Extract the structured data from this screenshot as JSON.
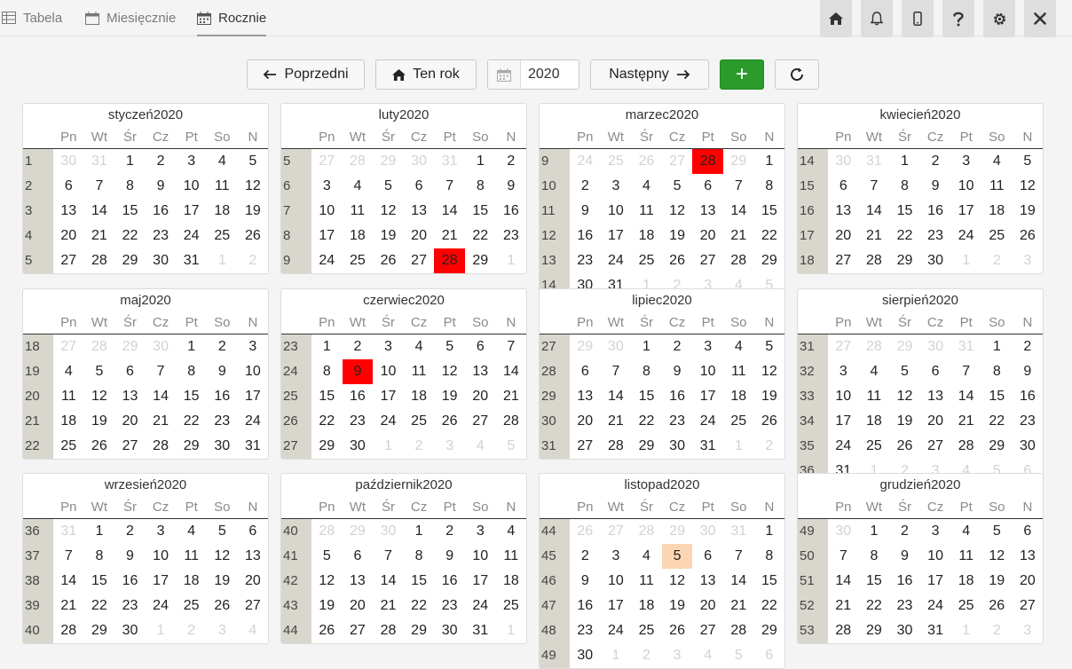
{
  "tabs": [
    {
      "label": "Tabela",
      "icon": "table-icon"
    },
    {
      "label": "Miesięcznie",
      "icon": "calendar-icon"
    },
    {
      "label": "Rocznie",
      "icon": "grid-calendar-icon"
    }
  ],
  "toolbar_icons": [
    "home-icon",
    "bell-icon",
    "phone-icon",
    "help-icon",
    "gear-icon",
    "close-icon"
  ],
  "nav": {
    "prev_label": "Poprzedni",
    "this_year_label": "Ten rok",
    "year_value": "2020",
    "next_label": "Następny",
    "add_label": "+"
  },
  "colors": {
    "accent_green": "#2b9b2b",
    "highlight_red": "#ff0000",
    "highlight_peach": "#fcd6b2",
    "week_column": "#d9d7cd"
  },
  "weekday_headers": [
    "Pn",
    "Wt",
    "Śr",
    "Cz",
    "Pt",
    "So",
    "N"
  ],
  "months": [
    {
      "title": "styczeń2020",
      "rows": [
        [
          "1",
          "30",
          "31",
          "1",
          "2",
          "3",
          "4",
          "5"
        ],
        [
          "2",
          "6",
          "7",
          "8",
          "9",
          "10",
          "11",
          "12"
        ],
        [
          "3",
          "13",
          "14",
          "15",
          "16",
          "17",
          "18",
          "19"
        ],
        [
          "4",
          "20",
          "21",
          "22",
          "23",
          "24",
          "25",
          "26"
        ],
        [
          "5",
          "27",
          "28",
          "29",
          "30",
          "31",
          "1",
          "2"
        ]
      ]
    },
    {
      "title": "luty2020",
      "rows": [
        [
          "5",
          "27",
          "28",
          "29",
          "30",
          "31",
          "1",
          "2"
        ],
        [
          "6",
          "3",
          "4",
          "5",
          "6",
          "7",
          "8",
          "9"
        ],
        [
          "7",
          "10",
          "11",
          "12",
          "13",
          "14",
          "15",
          "16"
        ],
        [
          "8",
          "17",
          "18",
          "19",
          "20",
          "21",
          "22",
          "23"
        ],
        [
          "9",
          "24",
          "25",
          "26",
          "27",
          "28",
          "29",
          "1"
        ]
      ]
    },
    {
      "title": "marzec2020",
      "rows": [
        [
          "9",
          "24",
          "25",
          "26",
          "27",
          "28",
          "29",
          "1"
        ],
        [
          "10",
          "2",
          "3",
          "4",
          "5",
          "6",
          "7",
          "8"
        ],
        [
          "11",
          "9",
          "10",
          "11",
          "12",
          "13",
          "14",
          "15"
        ],
        [
          "12",
          "16",
          "17",
          "18",
          "19",
          "20",
          "21",
          "22"
        ],
        [
          "13",
          "23",
          "24",
          "25",
          "26",
          "27",
          "28",
          "29"
        ],
        [
          "14",
          "30",
          "31",
          "1",
          "2",
          "3",
          "4",
          "5"
        ]
      ]
    },
    {
      "title": "kwiecień2020",
      "rows": [
        [
          "14",
          "30",
          "31",
          "1",
          "2",
          "3",
          "4",
          "5"
        ],
        [
          "15",
          "6",
          "7",
          "8",
          "9",
          "10",
          "11",
          "12"
        ],
        [
          "16",
          "13",
          "14",
          "15",
          "16",
          "17",
          "18",
          "19"
        ],
        [
          "17",
          "20",
          "21",
          "22",
          "23",
          "24",
          "25",
          "26"
        ],
        [
          "18",
          "27",
          "28",
          "29",
          "30",
          "1",
          "2",
          "3"
        ]
      ]
    },
    {
      "title": "maj2020",
      "rows": [
        [
          "18",
          "27",
          "28",
          "29",
          "30",
          "1",
          "2",
          "3"
        ],
        [
          "19",
          "4",
          "5",
          "6",
          "7",
          "8",
          "9",
          "10"
        ],
        [
          "20",
          "11",
          "12",
          "13",
          "14",
          "15",
          "16",
          "17"
        ],
        [
          "21",
          "18",
          "19",
          "20",
          "21",
          "22",
          "23",
          "24"
        ],
        [
          "22",
          "25",
          "26",
          "27",
          "28",
          "29",
          "30",
          "31"
        ]
      ]
    },
    {
      "title": "czerwiec2020",
      "rows": [
        [
          "23",
          "1",
          "2",
          "3",
          "4",
          "5",
          "6",
          "7"
        ],
        [
          "24",
          "8",
          "9",
          "10",
          "11",
          "12",
          "13",
          "14"
        ],
        [
          "25",
          "15",
          "16",
          "17",
          "18",
          "19",
          "20",
          "21"
        ],
        [
          "26",
          "22",
          "23",
          "24",
          "25",
          "26",
          "27",
          "28"
        ],
        [
          "27",
          "29",
          "30",
          "1",
          "2",
          "3",
          "4",
          "5"
        ]
      ]
    },
    {
      "title": "lipiec2020",
      "rows": [
        [
          "27",
          "29",
          "30",
          "1",
          "2",
          "3",
          "4",
          "5"
        ],
        [
          "28",
          "6",
          "7",
          "8",
          "9",
          "10",
          "11",
          "12"
        ],
        [
          "29",
          "13",
          "14",
          "15",
          "16",
          "17",
          "18",
          "19"
        ],
        [
          "30",
          "20",
          "21",
          "22",
          "23",
          "24",
          "25",
          "26"
        ],
        [
          "31",
          "27",
          "28",
          "29",
          "30",
          "31",
          "1",
          "2"
        ]
      ]
    },
    {
      "title": "sierpień2020",
      "rows": [
        [
          "31",
          "27",
          "28",
          "29",
          "30",
          "31",
          "1",
          "2"
        ],
        [
          "32",
          "3",
          "4",
          "5",
          "6",
          "7",
          "8",
          "9"
        ],
        [
          "33",
          "10",
          "11",
          "12",
          "13",
          "14",
          "15",
          "16"
        ],
        [
          "34",
          "17",
          "18",
          "19",
          "20",
          "21",
          "22",
          "23"
        ],
        [
          "35",
          "24",
          "25",
          "26",
          "27",
          "28",
          "29",
          "30"
        ],
        [
          "36",
          "31",
          "1",
          "2",
          "3",
          "4",
          "5",
          "6"
        ]
      ]
    },
    {
      "title": "wrzesień2020",
      "rows": [
        [
          "36",
          "31",
          "1",
          "2",
          "3",
          "4",
          "5",
          "6"
        ],
        [
          "37",
          "7",
          "8",
          "9",
          "10",
          "11",
          "12",
          "13"
        ],
        [
          "38",
          "14",
          "15",
          "16",
          "17",
          "18",
          "19",
          "20"
        ],
        [
          "39",
          "21",
          "22",
          "23",
          "24",
          "25",
          "26",
          "27"
        ],
        [
          "40",
          "28",
          "29",
          "30",
          "1",
          "2",
          "3",
          "4"
        ]
      ]
    },
    {
      "title": "październik2020",
      "rows": [
        [
          "40",
          "28",
          "29",
          "30",
          "1",
          "2",
          "3",
          "4"
        ],
        [
          "41",
          "5",
          "6",
          "7",
          "8",
          "9",
          "10",
          "11"
        ],
        [
          "42",
          "12",
          "13",
          "14",
          "15",
          "16",
          "17",
          "18"
        ],
        [
          "43",
          "19",
          "20",
          "21",
          "22",
          "23",
          "24",
          "25"
        ],
        [
          "44",
          "26",
          "27",
          "28",
          "29",
          "30",
          "31",
          "1"
        ]
      ]
    },
    {
      "title": "listopad2020",
      "rows": [
        [
          "44",
          "26",
          "27",
          "28",
          "29",
          "30",
          "31",
          "1"
        ],
        [
          "45",
          "2",
          "3",
          "4",
          "5",
          "6",
          "7",
          "8"
        ],
        [
          "46",
          "9",
          "10",
          "11",
          "12",
          "13",
          "14",
          "15"
        ],
        [
          "47",
          "16",
          "17",
          "18",
          "19",
          "20",
          "21",
          "22"
        ],
        [
          "48",
          "23",
          "24",
          "25",
          "26",
          "27",
          "28",
          "29"
        ],
        [
          "49",
          "30",
          "1",
          "2",
          "3",
          "4",
          "5",
          "6"
        ]
      ]
    },
    {
      "title": "grudzień2020",
      "rows": [
        [
          "49",
          "30",
          "1",
          "2",
          "3",
          "4",
          "5",
          "6"
        ],
        [
          "50",
          "7",
          "8",
          "9",
          "10",
          "11",
          "12",
          "13"
        ],
        [
          "51",
          "14",
          "15",
          "16",
          "17",
          "18",
          "19",
          "20"
        ],
        [
          "52",
          "21",
          "22",
          "23",
          "24",
          "25",
          "26",
          "27"
        ],
        [
          "53",
          "28",
          "29",
          "30",
          "31",
          "1",
          "2",
          "3"
        ]
      ]
    }
  ],
  "highlights": [
    {
      "month": 1,
      "row": 4,
      "col": 5,
      "kind": "red"
    },
    {
      "month": 2,
      "row": 0,
      "col": 5,
      "kind": "red"
    },
    {
      "month": 5,
      "row": 1,
      "col": 2,
      "kind": "red"
    },
    {
      "month": 10,
      "row": 1,
      "col": 4,
      "kind": "peach"
    }
  ]
}
